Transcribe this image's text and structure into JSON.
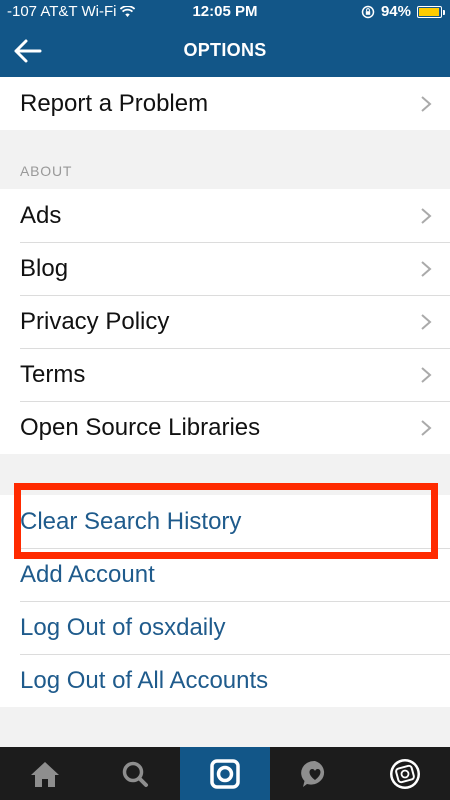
{
  "status": {
    "carrier": "-107 AT&T Wi-Fi",
    "time": "12:05 PM",
    "battery": "94%",
    "battery_level": 0.94
  },
  "nav": {
    "title": "OPTIONS",
    "back_icon": "arrow-left-icon"
  },
  "support": {
    "items": [
      {
        "label": "Report a Problem"
      }
    ]
  },
  "about": {
    "section_label": "ABOUT",
    "items": [
      {
        "label": "Ads"
      },
      {
        "label": "Blog"
      },
      {
        "label": "Privacy Policy"
      },
      {
        "label": "Terms"
      },
      {
        "label": "Open Source Libraries"
      }
    ]
  },
  "account": {
    "items": [
      {
        "label": "Clear Search History"
      },
      {
        "label": "Add Account"
      },
      {
        "label": "Log Out of osxdaily"
      },
      {
        "label": "Log Out of All Accounts"
      }
    ]
  },
  "colors": {
    "header": "#125688",
    "link": "#1f5b8c",
    "highlight": "#ff2a00",
    "tabbar": "#1c1c1c"
  },
  "tabs": [
    {
      "icon": "home-icon"
    },
    {
      "icon": "search-icon"
    },
    {
      "icon": "camera-icon",
      "active": true
    },
    {
      "icon": "heart-bubble-icon"
    },
    {
      "icon": "profile-icon"
    }
  ]
}
